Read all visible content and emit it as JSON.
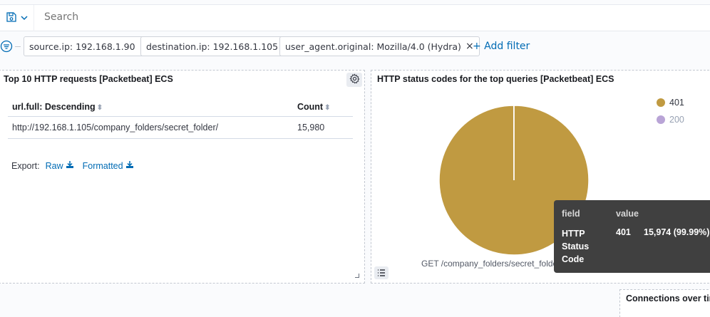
{
  "query_bar": {
    "placeholder": "Search"
  },
  "filters": [
    {
      "label": "source.ip: 192.168.1.90"
    },
    {
      "label": "destination.ip: 192.168.1.105"
    },
    {
      "label": "user_agent.original: Mozilla/4.0 (Hydra)"
    }
  ],
  "add_filter_label": "+ Add filter",
  "panel_requests": {
    "title": "Top 10 HTTP requests [Packetbeat] ECS",
    "columns": [
      "url.full: Descending",
      "Count"
    ],
    "rows": [
      {
        "url": "http://192.168.1.105/company_folders/secret_folder/",
        "count": "15,980"
      }
    ],
    "export_label": "Export:",
    "raw_label": "Raw",
    "formatted_label": "Formatted"
  },
  "panel_status": {
    "title": "HTTP status codes for the top queries [Packetbeat] ECS",
    "legend": [
      {
        "label": "401",
        "color": "#c09a41"
      },
      {
        "label": "200",
        "color": "#b9a4d6"
      }
    ],
    "pie_label": "GET /company_folders/secret_folder",
    "tooltip": {
      "col_field": "field",
      "col_value": "value",
      "field": "HTTP Status Code",
      "value": "401",
      "count": "15,974 (99.99%)"
    }
  },
  "chart_data": {
    "type": "pie",
    "title": "HTTP status codes for the top queries [Packetbeat] ECS",
    "categories": [
      "401",
      "200"
    ],
    "values": [
      15974,
      6
    ],
    "colors": [
      "#c09a41",
      "#b9a4d6"
    ]
  },
  "panel_connections": {
    "title": "Connections over tir"
  }
}
